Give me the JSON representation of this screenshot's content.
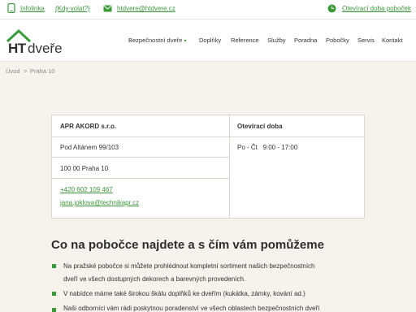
{
  "topbar": {
    "infolinka": "Infolinka",
    "kdy_volat": "(Kdy volat?)",
    "email": "htdvere@htdvere.cz",
    "oteviraci_doba": "Otevírací doba poboček"
  },
  "header": {
    "logo_ht": "HT",
    "logo_dvere": "dveře",
    "nav": [
      {
        "label": "Bezpečnostní dveře"
      },
      {
        "label": "Doplňky"
      },
      {
        "label": "Reference"
      },
      {
        "label": "Služby"
      },
      {
        "label": "Poradna"
      },
      {
        "label": "Pobočky"
      },
      {
        "label": "Servis"
      },
      {
        "label": "Kontakt"
      }
    ]
  },
  "breadcrumb": {
    "home": "Úvod",
    "separator": ">",
    "current": "Praha 10"
  },
  "branch": {
    "name": "APR AKORD s.r.o.",
    "street": "Pod Altánem 99/103",
    "city": "100 00 Praha 10",
    "phone": "+420 602 109 467",
    "email": "jana.joklova@technikapr.cz",
    "hours_title": "Otevírací doba",
    "hours": "Po - Čt   9:00 - 17:00"
  },
  "section": {
    "title": "Co na pobočce najdete a s čím vám pomůžeme",
    "bullets": [
      [
        "Na pražské pobočce si můžete prohlédnout kompletní sortiment našich bezpečnostních",
        "dveří ve všech dostupných dekorech a barevných provedeních."
      ],
      [
        "V nabídce máme také širokou škálu doplňků ke dveřím (kukátka, zámky, kování ad.)"
      ],
      [
        "Naši odborníci vám rádi poskytnou poradenství ve všech oblastech bezpečnostních dveří"
      ]
    ]
  },
  "colors": {
    "accent": "#3a9a3a",
    "background": "#f7f2ec"
  }
}
